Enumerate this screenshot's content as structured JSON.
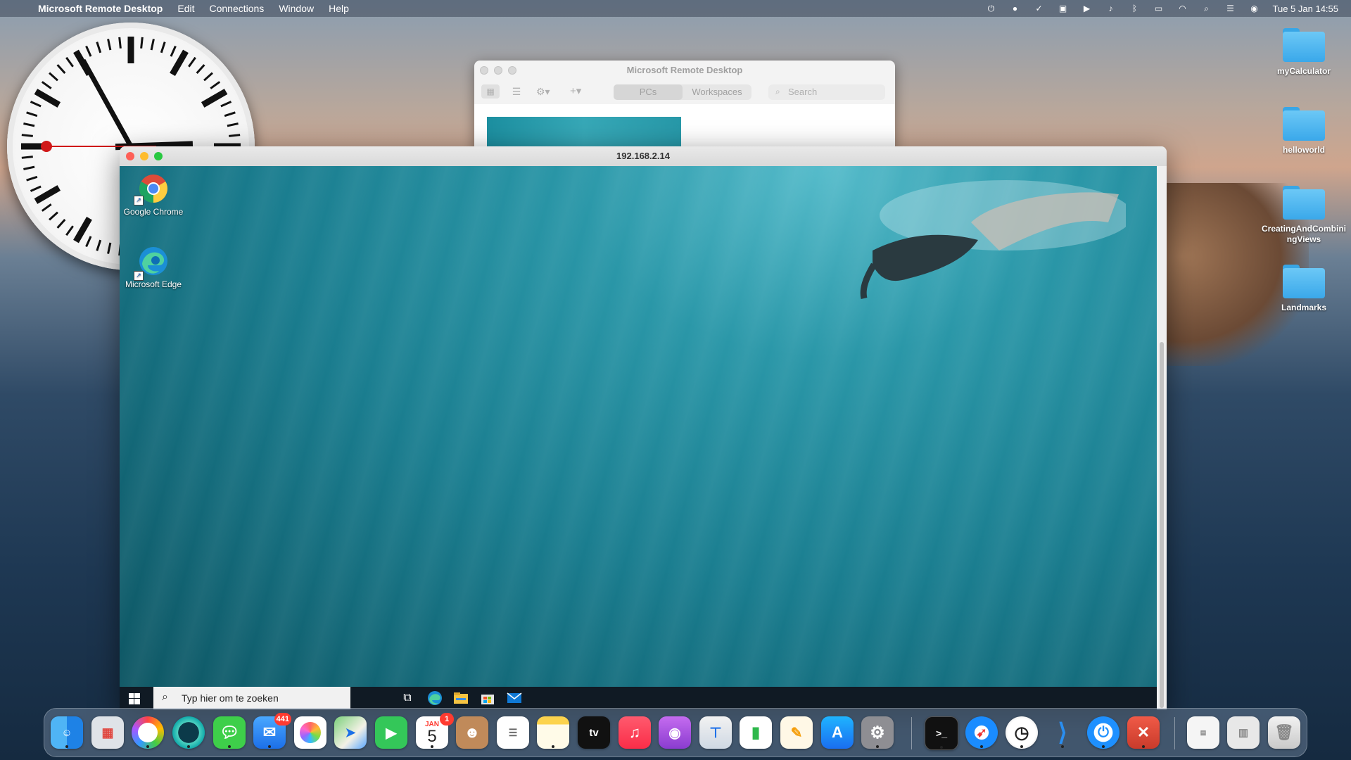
{
  "menubar": {
    "app_name": "Microsoft Remote Desktop",
    "items": [
      "Edit",
      "Connections",
      "Window",
      "Help"
    ],
    "datetime": "Tue 5 Jan  14:55"
  },
  "desktop_icons": [
    {
      "label": "myCalculator"
    },
    {
      "label": "helloworld"
    },
    {
      "label": "CreatingAndCombiningViews"
    },
    {
      "label": "Landmarks"
    }
  ],
  "back_window": {
    "title": "Microsoft Remote Desktop",
    "tabs": [
      "PCs",
      "Workspaces"
    ],
    "active_tab": "PCs",
    "search_placeholder": "Search"
  },
  "rdp_window": {
    "title": "192.168.2.14",
    "remote_icons": [
      {
        "label": "Google Chrome",
        "icon": "chrome-icon"
      },
      {
        "label": "Microsoft Edge",
        "icon": "edge-icon"
      }
    ],
    "taskbar": {
      "search_placeholder": "Typ hier om te zoeken"
    }
  },
  "dock": {
    "mail_badge": "441",
    "calendar_month": "JAN",
    "calendar_day": "5",
    "calendar_badge": "1",
    "tv_label": "tv"
  },
  "colors": {
    "accent_blue": "#3aa8ea",
    "close_red": "#fe5f57",
    "minimize_yellow": "#febc2e",
    "zoom_green": "#28c840",
    "badge_red": "#ff3b30"
  }
}
